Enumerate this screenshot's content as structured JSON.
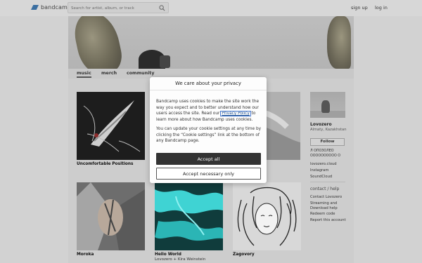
{
  "header": {
    "logo_text": "bandcamp",
    "search_placeholder": "Search for artist, album, or track",
    "sign_up": "sign up",
    "log_in": "log in"
  },
  "tabs": [
    {
      "label": "music",
      "active": true
    },
    {
      "label": "merch",
      "active": false
    },
    {
      "label": "community",
      "active": false
    }
  ],
  "albums": [
    {
      "title": "Uncomfortable Positions",
      "artist": ""
    },
    {
      "title": "Moroka",
      "artist": ""
    },
    {
      "title": "Hello World",
      "artist": "Lovozero + Kira Weinstein"
    },
    {
      "title": "Zagovory",
      "artist": ""
    }
  ],
  "sidebar": {
    "band_name": "Lovozero",
    "location": "Almaty, Kazakhstan",
    "follow_label": "Follow",
    "bio_line1": "Л ОПОЗОЛЕО",
    "bio_line2": "ОООООООООО О",
    "links": [
      "lovozero.cloud",
      "Instagram",
      "SoundCloud"
    ],
    "contact_heading": "contact / help",
    "contact_links": [
      "Contact Lovozero",
      "Streaming and",
      "Download help",
      "Redeem code",
      "Report this account"
    ]
  },
  "cookie_modal": {
    "title": "We care about your privacy",
    "para1_before": "Bandcamp uses cookies to make the site work the way you expect and to better understand how our users access the site. Read our ",
    "privacy_link": "Privacy Policy",
    "para1_after": " to learn more about how Bandcamp uses cookies.",
    "para2": "You can update your cookie settings at any time by clicking the “Cookie settings” link at the bottom of any Bandcamp page.",
    "accept_all": "Accept all",
    "accept_necessary": "Accept necessary only"
  }
}
